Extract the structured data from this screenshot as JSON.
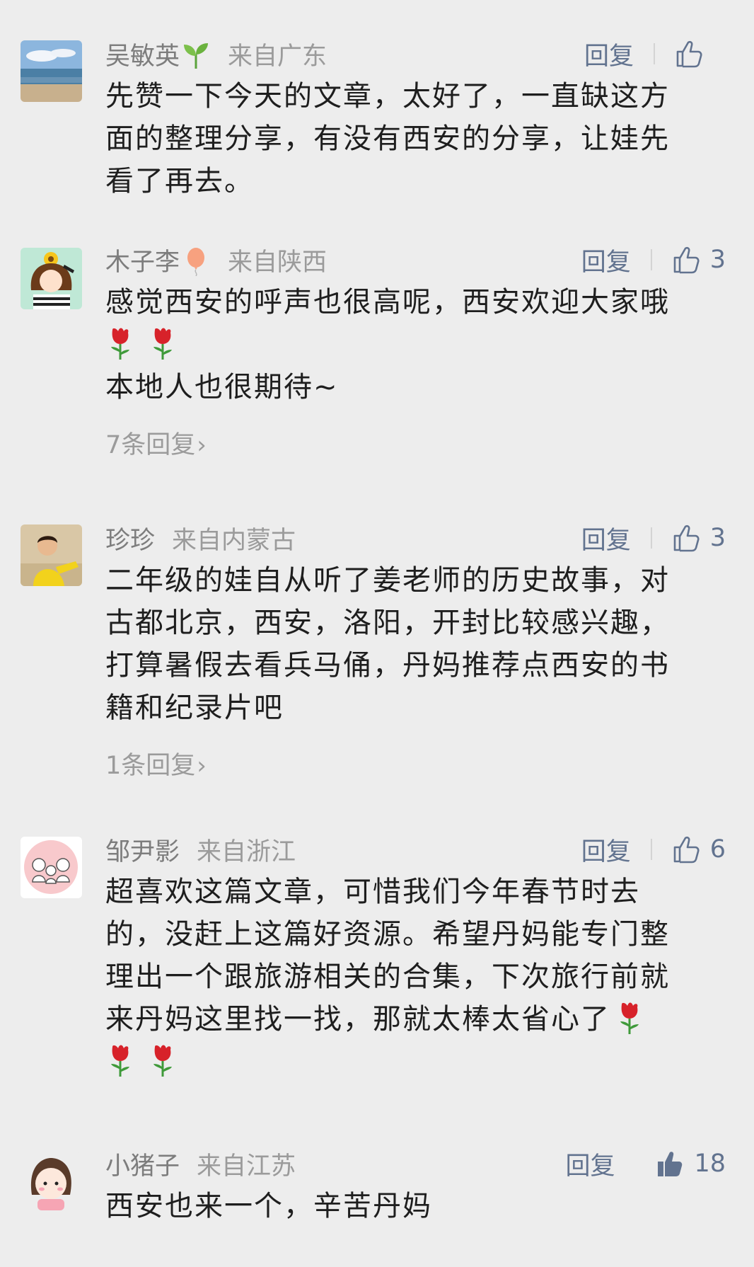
{
  "colors": {
    "background": "#ededed",
    "username": "#7d7d7d",
    "location": "#9b9b9b",
    "action": "#62738f",
    "body": "#1e1e1e"
  },
  "comments": [
    {
      "username": "吴敏英",
      "name_emoji": "seedling-icon",
      "location": "来自广东",
      "reply_label": "回复",
      "like_count": "",
      "liked": false,
      "lines": [
        "先赞一下今天的文章，太好了，一直缺这方",
        "面的整理分享，有没有西安的分享，让娃先",
        "看了再去。"
      ]
    },
    {
      "username": "木子李",
      "name_emoji": "balloon-icon",
      "location": "来自陕西",
      "reply_label": "回复",
      "like_count": "3",
      "liked": false,
      "lines": [
        "感觉西安的呼声也很高呢，西安欢迎大家哦",
        "",
        "本地人也很期待~"
      ],
      "roses": 2,
      "more_replies": "7条回复"
    },
    {
      "username": "珍珍",
      "location": "来自内蒙古",
      "reply_label": "回复",
      "like_count": "3",
      "liked": false,
      "lines": [
        "二年级的娃自从听了姜老师的历史故事，对",
        "古都北京，西安，洛阳，开封比较感兴趣，",
        "打算暑假去看兵马俑，丹妈推荐点西安的书",
        "籍和纪录片吧"
      ],
      "more_replies": "1条回复"
    },
    {
      "username": "邹尹影",
      "location": "来自浙江",
      "reply_label": "回复",
      "like_count": "6",
      "liked": false,
      "lines": [
        "超喜欢这篇文章，可惜我们今年春节时去",
        "的，没赶上这篇好资源。希望丹妈能专门整",
        "理出一个跟旅游相关的合集，下次旅行前就",
        "来丹妈这里找一找，那就太棒太省心了"
      ]
    },
    {
      "username": "小猪子",
      "location": "来自江苏",
      "reply_label": "回复",
      "like_count": "18",
      "liked": true,
      "lines": [
        "西安也来一个，辛苦丹妈"
      ]
    }
  ]
}
